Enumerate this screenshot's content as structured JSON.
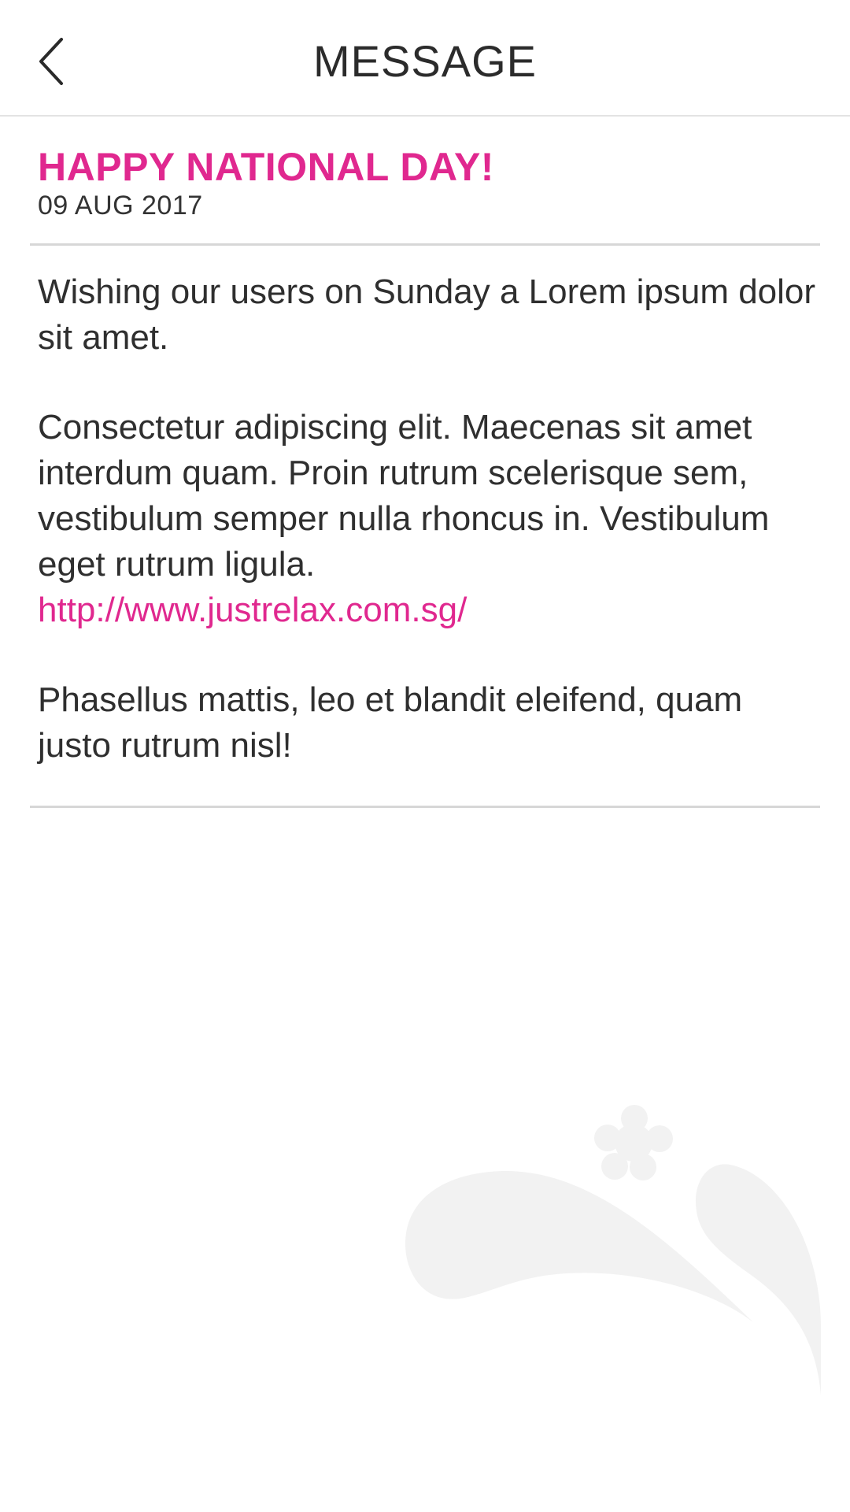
{
  "header": {
    "back_icon": "chevron-left-icon",
    "title": "MESSAGE"
  },
  "message": {
    "title": "HAPPY NATIONAL DAY!",
    "date": "09 AUG 2017",
    "paragraph_1": "Wishing our users on Sunday a Lorem ipsum dolor sit amet.",
    "paragraph_2": "Consectetur adipiscing elit. Maecenas sit amet interdum quam. Proin rutrum scelerisque sem, vestibulum semper nulla rhoncus in. Vestibulum eget rutrum ligula.",
    "link": "http://www.justrelax.com.sg/",
    "paragraph_3": "Phasellus mattis, leo et blandit eleifend, quam justo rutrum nisl!"
  },
  "colors": {
    "accent": "#e0288f",
    "text": "#2f2f2f",
    "divider": "#d7d7d7",
    "watermark": "#f2f2f2"
  },
  "decor": {
    "watermark_icon": "brand-swirl-flower-icon"
  }
}
